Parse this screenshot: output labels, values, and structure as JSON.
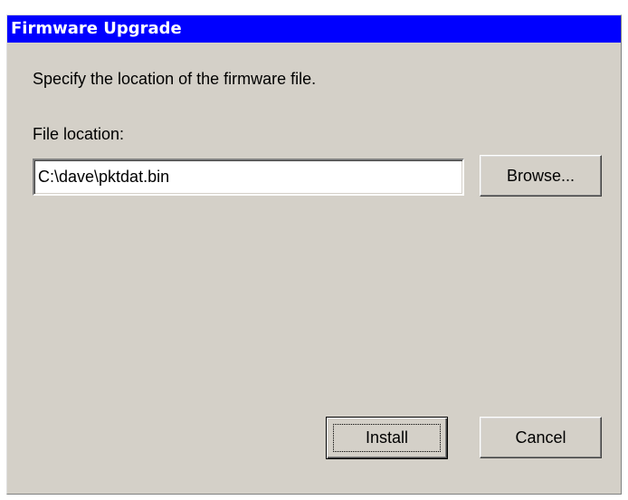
{
  "dialog": {
    "title": "Firmware Upgrade",
    "instruction": "Specify the location of the firmware file.",
    "file_location_label": "File location:",
    "file_location_value": "C:\\dave\\pktdat.bin",
    "browse_label": "Browse...",
    "install_label": "Install",
    "cancel_label": "Cancel"
  },
  "colors": {
    "titlebar": "#0000ff",
    "dialog_background": "#d4d0c8",
    "field_background": "#ffffff"
  }
}
